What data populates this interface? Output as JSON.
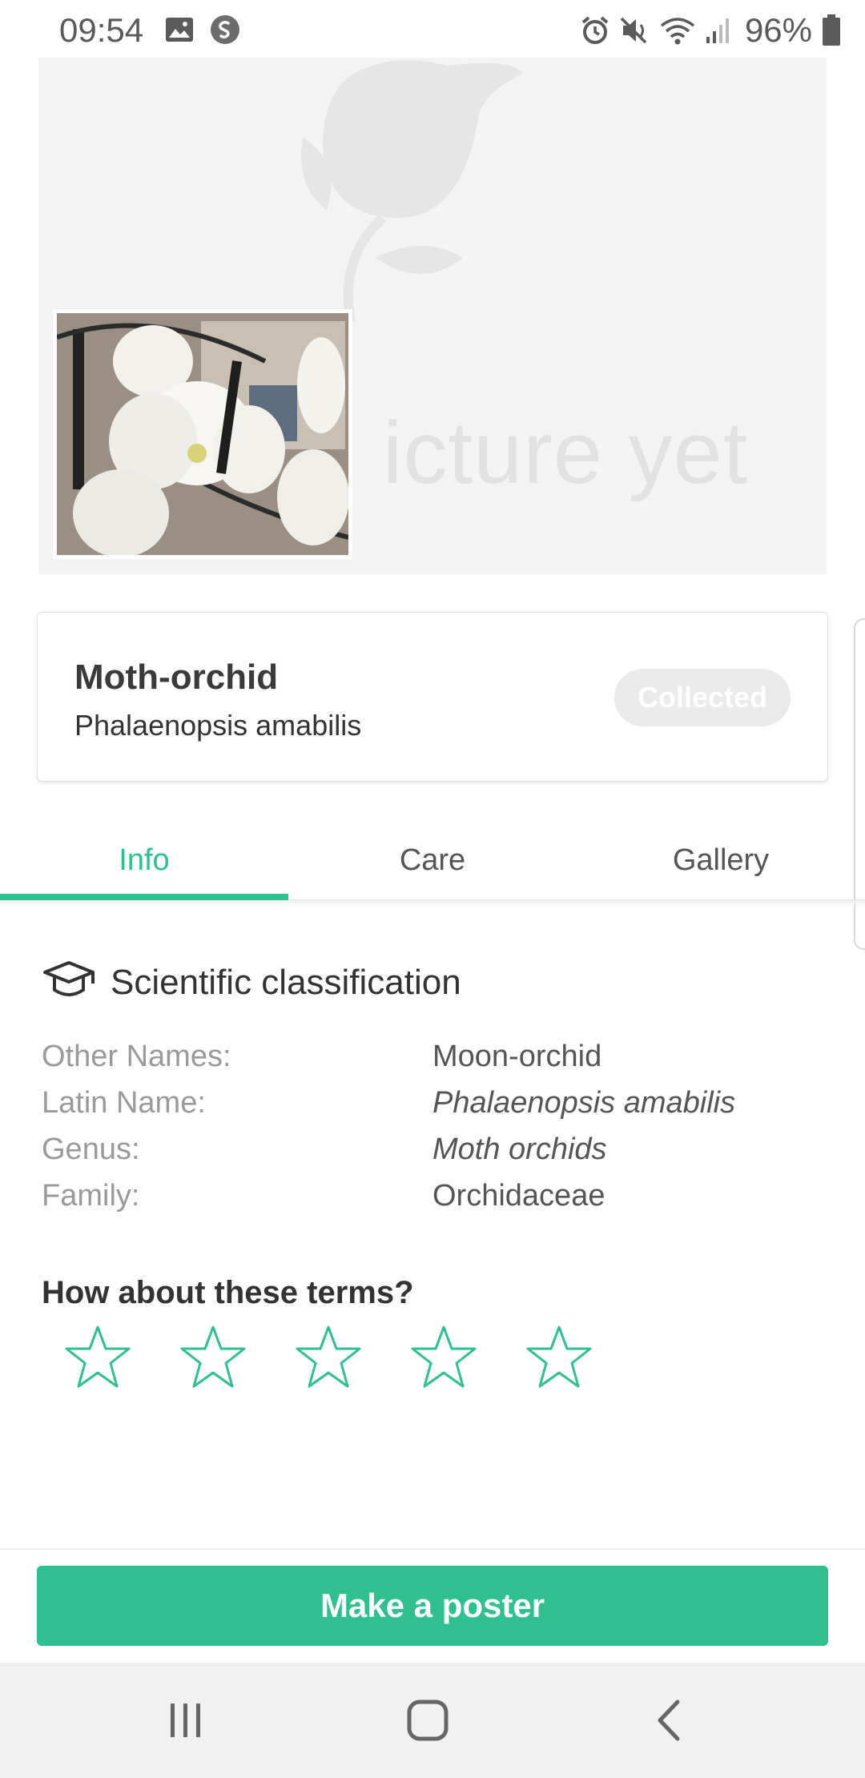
{
  "status_bar": {
    "time": "09:54",
    "battery_percent": "96%",
    "left_icons": [
      "image-icon",
      "shazam-icon"
    ],
    "right_icons": [
      "alarm-icon",
      "mute-icon",
      "wifi-icon",
      "signal-icon",
      "battery-icon"
    ]
  },
  "hero": {
    "placeholder_text": "icture yet"
  },
  "plant": {
    "common_name": "Moth-orchid",
    "latin_name": "Phalaenopsis amabilis",
    "collected_label": "Collected"
  },
  "tabs": [
    {
      "label": "Info",
      "active": true
    },
    {
      "label": "Care",
      "active": false
    },
    {
      "label": "Gallery",
      "active": false
    }
  ],
  "classification": {
    "title": "Scientific classification",
    "rows": [
      {
        "label": "Other Names:",
        "value": "Moon-orchid",
        "italic": false
      },
      {
        "label": "Latin Name:",
        "value": "Phalaenopsis amabilis",
        "italic": true
      },
      {
        "label": "Genus:",
        "value": "Moth orchids",
        "italic": true
      },
      {
        "label": "Family:",
        "value": "Orchidaceae",
        "italic": false
      }
    ]
  },
  "rating": {
    "question": "How about these terms?",
    "stars_total": 5,
    "stars_selected": 0
  },
  "actions": {
    "poster_label": "Make a poster"
  },
  "colors": {
    "accent": "#2fbf90",
    "muted_label": "#9a9a9a",
    "collected_bg": "#ebebeb"
  }
}
